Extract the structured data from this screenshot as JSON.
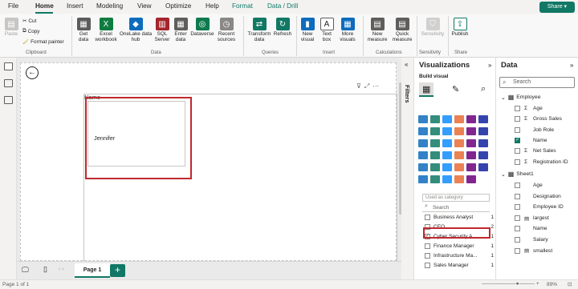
{
  "tabs": [
    "File",
    "Home",
    "Insert",
    "Modeling",
    "View",
    "Optimize",
    "Help",
    "Format",
    "Data / Drill"
  ],
  "share_label": "Share",
  "ribbon": {
    "clipboard": {
      "paste": "Paste",
      "cut": "Cut",
      "copy": "Copy",
      "format_painter": "Format painter",
      "group": "Clipboard"
    },
    "data": {
      "get_data": "Get data",
      "excel": "Excel workbook",
      "onelake": "OneLake data hub",
      "sql": "SQL Server",
      "enter_data": "Enter data",
      "dataverse": "Dataverse",
      "recent": "Recent sources",
      "group": "Data"
    },
    "queries": {
      "transform": "Transform data",
      "refresh": "Refresh",
      "group": "Queries"
    },
    "insert": {
      "new_visual": "New visual",
      "text_box": "Text box",
      "more_visuals": "More visuals",
      "group": "Insert"
    },
    "calculations": {
      "new_measure": "New measure",
      "quick_measure": "Quick measure",
      "group": "Calculations"
    },
    "sensitivity": {
      "label": "Sensitivity",
      "group": "Sensitivity"
    },
    "share": {
      "publish": "Publish",
      "group": "Share"
    }
  },
  "canvas": {
    "visual_title": "Name",
    "card_value": "Jennifer"
  },
  "page_tab": "Page 1",
  "status": {
    "left": "Page 1 of 1",
    "zoom": "89%"
  },
  "filters_label": "Filters",
  "visualizations": {
    "title": "Visualizations",
    "build": "Build visual",
    "dropdown": "Used as category",
    "search_placeholder": "Search",
    "items": [
      {
        "label": "Business Analyst",
        "count": "1",
        "checked": false
      },
      {
        "label": "CEO",
        "count": "2",
        "checked": false
      },
      {
        "label": "Cyber Security A...",
        "count": "1",
        "checked": true
      },
      {
        "label": "Finance Manager",
        "count": "1",
        "checked": false
      },
      {
        "label": "Infrastructure Ma...",
        "count": "1",
        "checked": false
      },
      {
        "label": "Sales Manager",
        "count": "1",
        "checked": false
      }
    ]
  },
  "data_pane": {
    "title": "Data",
    "search_placeholder": "Search",
    "employee_table": "Employee",
    "employee_fields": [
      {
        "label": "Age",
        "sigma": true,
        "checked": false
      },
      {
        "label": "Gross Sales",
        "sigma": true,
        "checked": false
      },
      {
        "label": "Job Role",
        "sigma": false,
        "checked": false
      },
      {
        "label": "Name",
        "sigma": false,
        "checked": true
      },
      {
        "label": "Net Sales",
        "sigma": true,
        "checked": false
      },
      {
        "label": "Registration ID",
        "sigma": true,
        "checked": false
      }
    ],
    "sheet_table": "Sheet1",
    "sheet_fields": [
      {
        "label": "Age",
        "kind": "plain"
      },
      {
        "label": "Designation",
        "kind": "plain"
      },
      {
        "label": "Employee ID",
        "kind": "plain"
      },
      {
        "label": "largest",
        "kind": "calc"
      },
      {
        "label": "Name",
        "kind": "plain"
      },
      {
        "label": "Salary",
        "kind": "plain"
      },
      {
        "label": "smallest",
        "kind": "calc"
      }
    ]
  },
  "colors": {
    "accent": "#117865",
    "highlight": "#c0282e"
  }
}
